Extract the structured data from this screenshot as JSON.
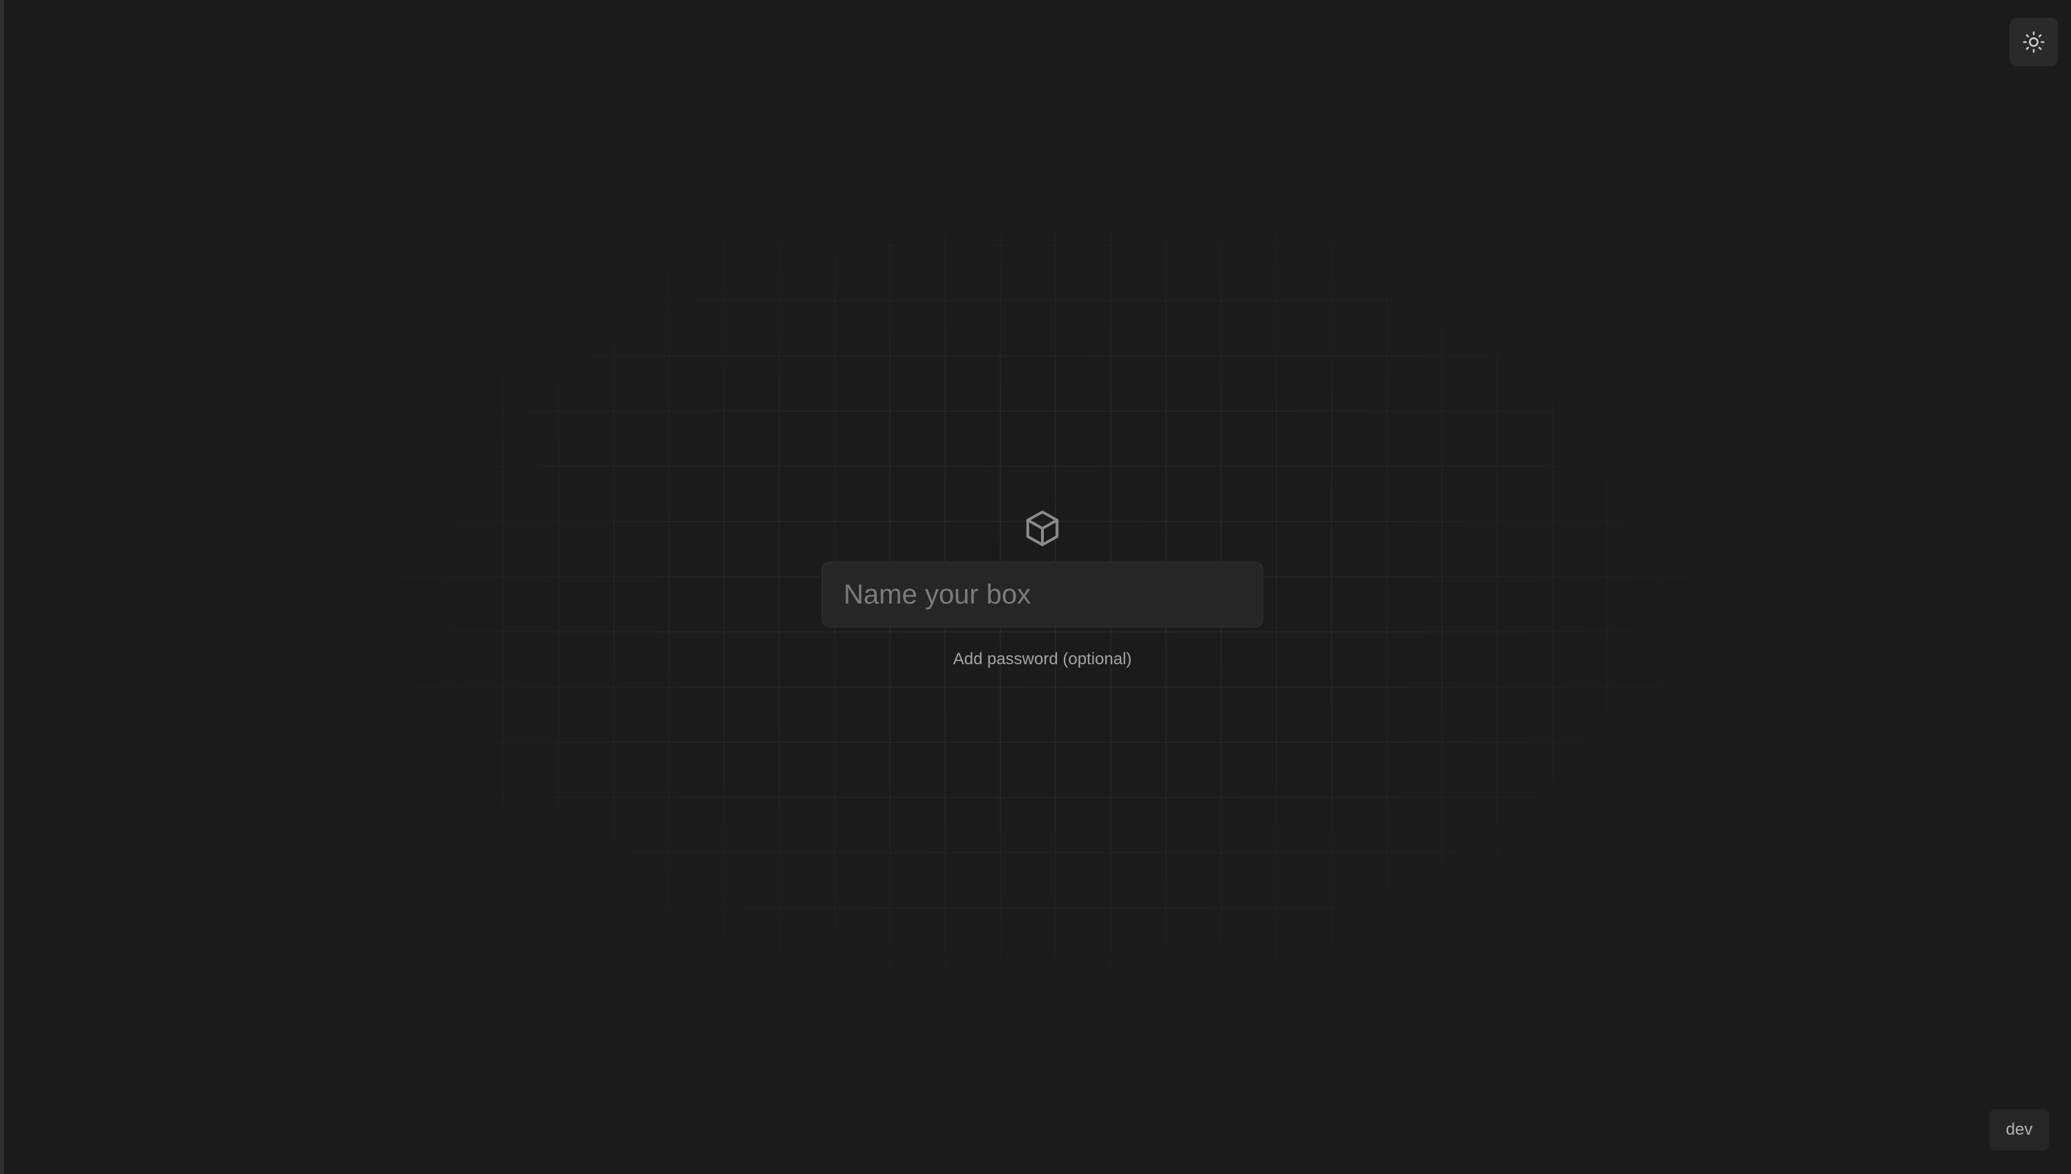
{
  "header": {
    "theme_toggle_icon": "sun-icon"
  },
  "main": {
    "logo_icon": "box-icon",
    "name_input": {
      "value": "",
      "placeholder": "Name your box"
    },
    "add_password_label": "Add password (optional)"
  },
  "footer": {
    "env_badge": "dev"
  },
  "colors": {
    "background": "#1b1b1b",
    "input_background": "#262626",
    "muted_text": "#a3a3a3",
    "icon": "#8a8a8a"
  }
}
